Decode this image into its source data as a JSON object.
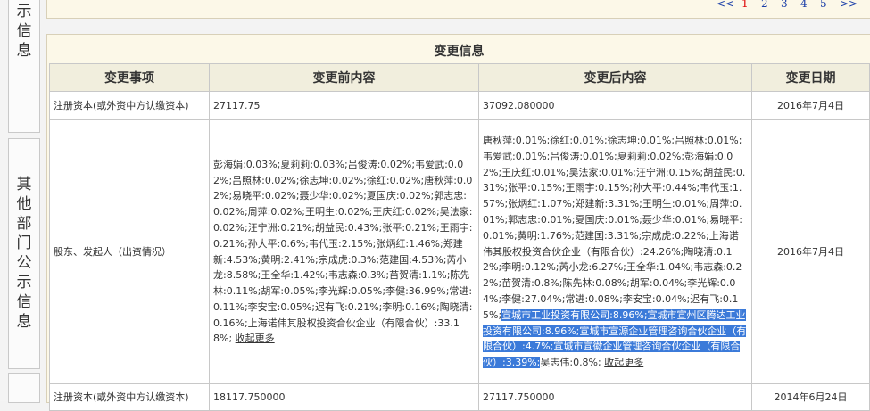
{
  "side_nav": [
    {
      "label": "示信息"
    },
    {
      "label": "其他部门公示信息"
    }
  ],
  "pager": {
    "prev": "<<",
    "pages": [
      "1",
      "2",
      "3",
      "4",
      "5"
    ],
    "current": "1",
    "next": ">>"
  },
  "section": {
    "title": "变更信息",
    "headers": [
      "变更事项",
      "变更前内容",
      "变更后内容",
      "变更日期"
    ],
    "rows": [
      {
        "item": "注册资本(或外资中方认缴资本)",
        "before": "27117.75",
        "after": "37092.080000",
        "date": "2016年7月4日"
      },
      {
        "item": "股东、发起人（出资情况）",
        "before": "彭海娟:0.03%;夏莉莉:0.03%;吕俊涛:0.02%;韦爱武:0.02%;吕照林:0.02%;徐志坤:0.02%;徐红:0.02%;唐秋萍:0.02%;易晓平:0.02%;聂少华:0.02%;夏国庆:0.02%;郭志忠:0.02%;周萍:0.02%;王明生:0.02%;王庆红:0.02%;吴法家:0.02%;汪宁洲:0.21%;胡益民:0.43%;张平:0.21%;王雨宇:0.21%;孙大平:0.6%;韦代玉:2.15%;张炳红:1.46%;郑建新:4.53%;黄明:2.41%;宗成虎:0.3%;范建国:4.53%;芮小龙:8.58%;王全华:1.42%;韦志森:0.3%;苗贺清:1.1%;陈先林:0.11%;胡军:0.05%;李光辉:0.05%;李健:36.99%;常进:0.11%;李安宝:0.05%;迟有飞:0.21%;李明:0.16%;陶晓清:0.16%;上海诺伟其股权投资合伙企业（有限合伙）:33.18%;",
        "after_a": "唐秋萍:0.01%;徐红:0.01%;徐志坤:0.01%;吕照林:0.01%;韦爱武:0.01%;吕俊涛:0.01%;夏莉莉:0.02%;彭海娟:0.02%;王庆红:0.01%;吴法家:0.01%;汪宁洲:0.15%;胡益民:0.31%;张平:0.15%;王雨宇:0.15%;孙大平:0.44%;韦代玉:1.57%;张炳红:1.07%;郑建新:3.31%;王明生:0.01%;周萍:0.01%;郭志忠:0.01%;夏国庆:0.01%;聂少华:0.01%;易晓平:0.01%;黄明:1.76%;范建国:3.31%;宗成虎:0.22%;上海诺伟其股权投资合伙企业（有限合伙）:24.26%;陶晓清:0.12%;李明:0.12%;芮小龙:6.27%;王全华:1.04%;韦志森:0.22%;苗贺清:0.8%;陈先林:0.08%;胡军:0.04%;李光辉:0.04%;李健:27.04%;常进:0.08%;李安宝:0.04%;迟有飞:0.15%;",
        "after_hl": "宣城市工业投资有限公司:8.96%;宣城市宣州区腾达工业投资有限公司:8.96%;宣城市宣源企业管理咨询合伙企业（有限合伙）:4.7%;宣城市宣徽企业管理咨询合伙企业（有限合伙）:3.39%;",
        "after_b": "吴志伟:0.8%;",
        "date": "2016年7月4日"
      },
      {
        "item": "注册资本(或外资中方认缴资本)",
        "before": "18117.750000",
        "after": "27117.750000",
        "date": "2014年6月24日"
      }
    ],
    "collapse_label": "收起更多"
  }
}
